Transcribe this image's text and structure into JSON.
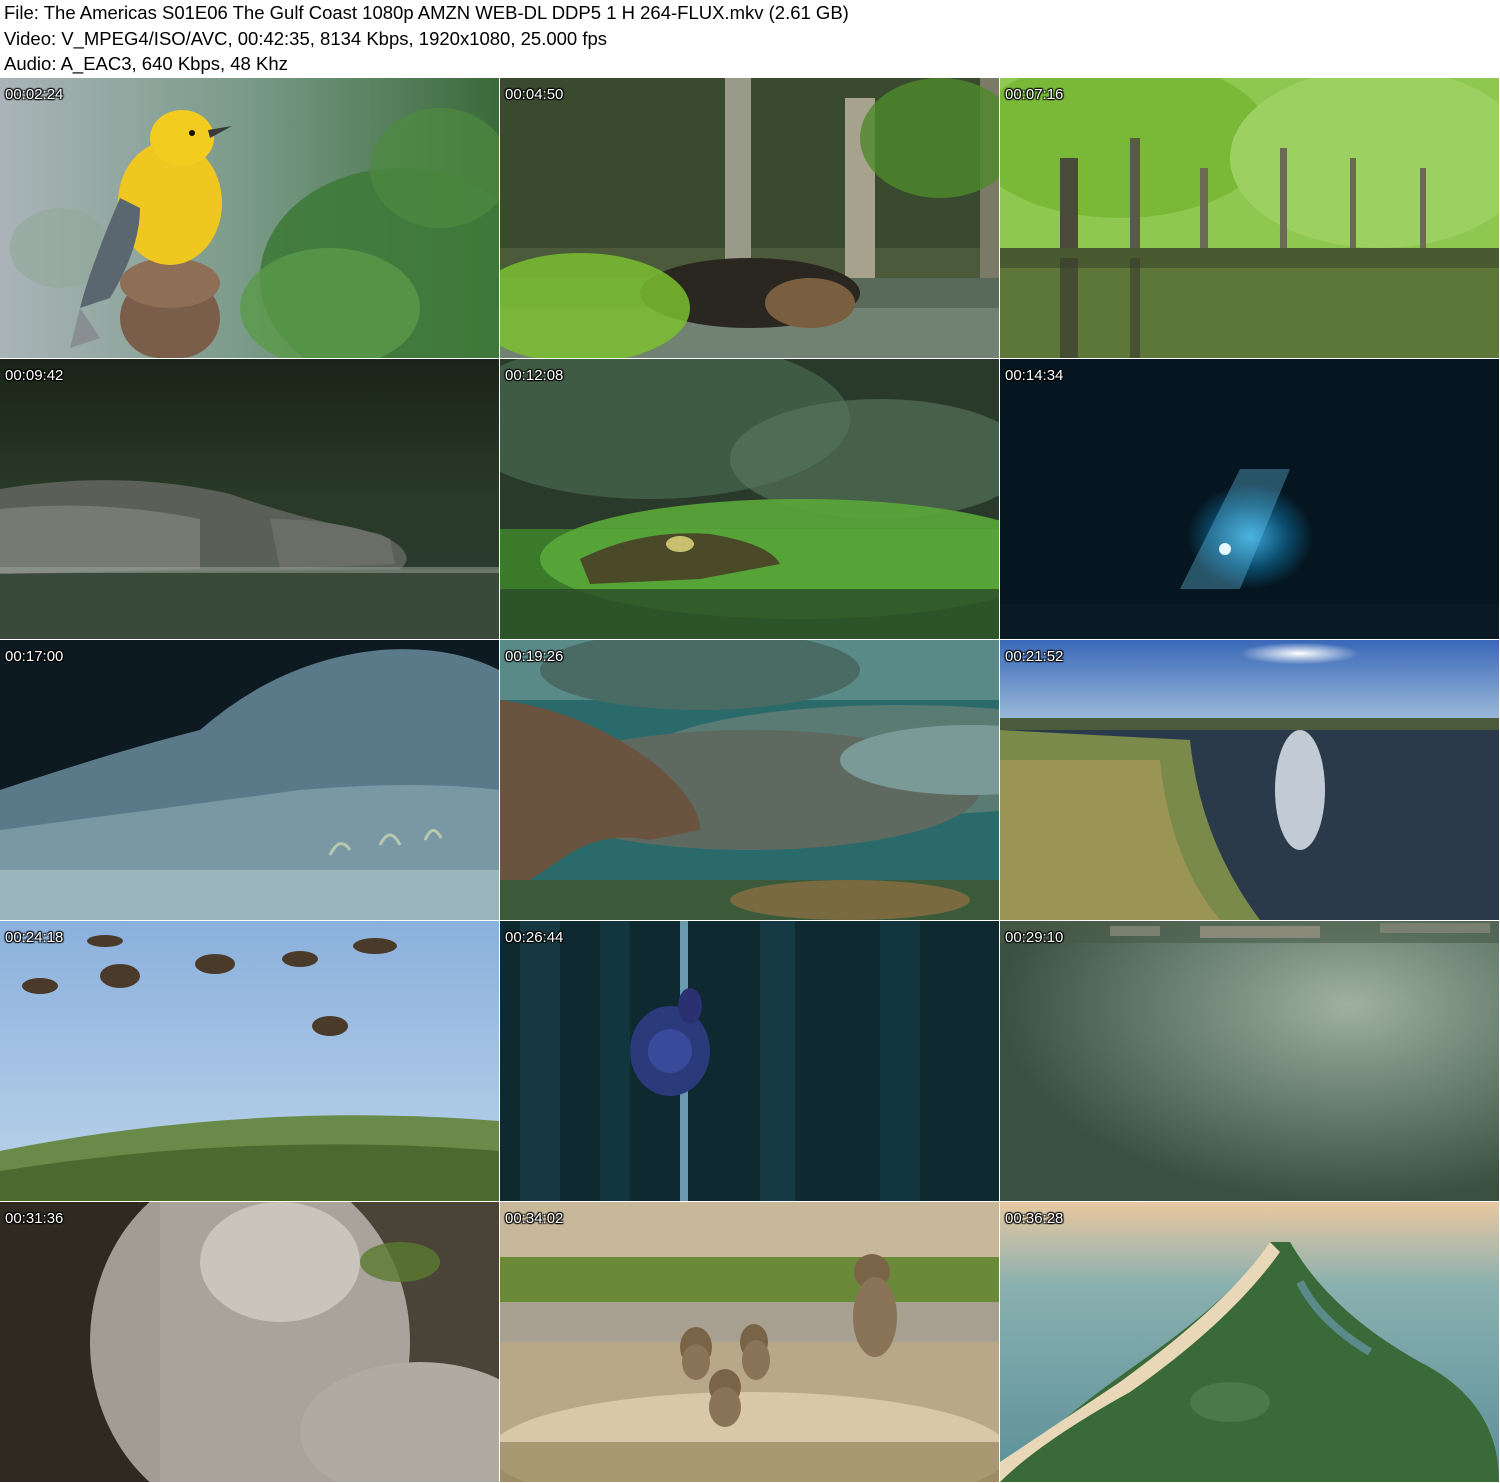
{
  "header": {
    "file_line": "File: The Americas S01E06 The Gulf Coast 1080p AMZN WEB-DL DDP5 1 H 264-FLUX.mkv (2.61 GB)",
    "video_line": "Video: V_MPEG4/ISO/AVC, 00:42:35, 8134 Kbps, 1920x1080, 25.000 fps",
    "audio_line": "Audio: A_EAC3, 640 Kbps, 48 Khz"
  },
  "thumbnails": [
    {
      "timestamp": "00:02:24",
      "scene": "yellow-songbird"
    },
    {
      "timestamp": "00:04:50",
      "scene": "bear-in-water"
    },
    {
      "timestamp": "00:07:16",
      "scene": "flooded-forest"
    },
    {
      "timestamp": "00:09:42",
      "scene": "alligator-dark"
    },
    {
      "timestamp": "00:12:08",
      "scene": "baby-alligator-grass"
    },
    {
      "timestamp": "00:14:34",
      "scene": "underwater-cave-diver"
    },
    {
      "timestamp": "00:17:00",
      "scene": "cave-floor-eels"
    },
    {
      "timestamp": "00:19:26",
      "scene": "manatees"
    },
    {
      "timestamp": "00:21:52",
      "scene": "marsh-sunset"
    },
    {
      "timestamp": "00:24:18",
      "scene": "birds-flying-grass"
    },
    {
      "timestamp": "00:26:44",
      "scene": "snail-on-reed"
    },
    {
      "timestamp": "00:29:10",
      "scene": "aerial-water"
    },
    {
      "timestamp": "00:31:36",
      "scene": "sand-burrow-dust"
    },
    {
      "timestamp": "00:34:02",
      "scene": "burrowing-owls"
    },
    {
      "timestamp": "00:36:28",
      "scene": "barrier-island-aerial"
    }
  ]
}
